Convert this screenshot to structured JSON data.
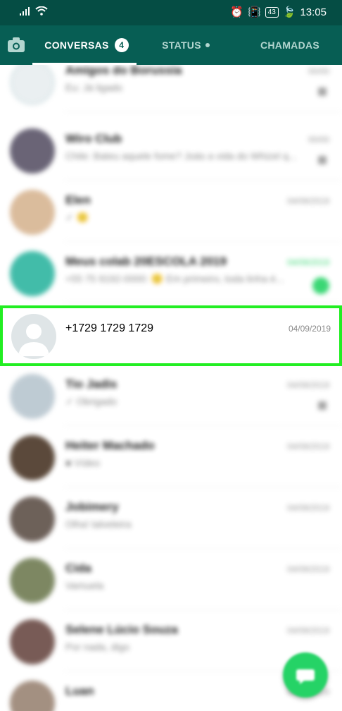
{
  "status_bar": {
    "time": "13:05",
    "battery": "43"
  },
  "tabs": [
    {
      "label": "CONVERSAS",
      "badge": "4"
    },
    {
      "label": "STATUS"
    },
    {
      "label": "CHAMADAS"
    }
  ],
  "chats": [
    {
      "name": "Amigos do Borussia",
      "preview": "Eu: Já ligado",
      "date": "00/00"
    },
    {
      "name": "Wiro Club",
      "preview": "Chile: Bateu aquele fome? Joás a vida do Whizel q...",
      "date": "00/00"
    },
    {
      "name": "Elen",
      "preview": "✓ 🙂",
      "date": "04/09/2019"
    },
    {
      "name": "Meus colab 20ESCOLA 2019",
      "preview": "+55 75 9192-0000: 🙂 Em primeiro, toda linha é...",
      "date": "04/09/2019"
    },
    {
      "name": "+1729 1729 1729",
      "preview": "",
      "date": "04/09/2019"
    },
    {
      "name": "Tio Jadis",
      "preview": "✓ Obrigado",
      "date": "04/09/2019"
    },
    {
      "name": "Heiter Machado",
      "preview": "■ Vídeo",
      "date": "04/09/2019"
    },
    {
      "name": "Jobimery",
      "preview": "Olha! talveleira",
      "date": "04/09/2019"
    },
    {
      "name": "Cida",
      "preview": "Vamuela",
      "date": "04/09/2019"
    },
    {
      "name": "Selene Lúcio Souza",
      "preview": "Por nada, digo",
      "date": "04/09/2019"
    },
    {
      "name": "Luan",
      "preview": "",
      "date": "04/09/2019"
    }
  ],
  "colors": {
    "header": "#075e54",
    "accent": "#25d366",
    "highlight_border": "#22ee22"
  },
  "icons": {
    "camera": "camera-icon",
    "fab": "new-chat-icon"
  }
}
